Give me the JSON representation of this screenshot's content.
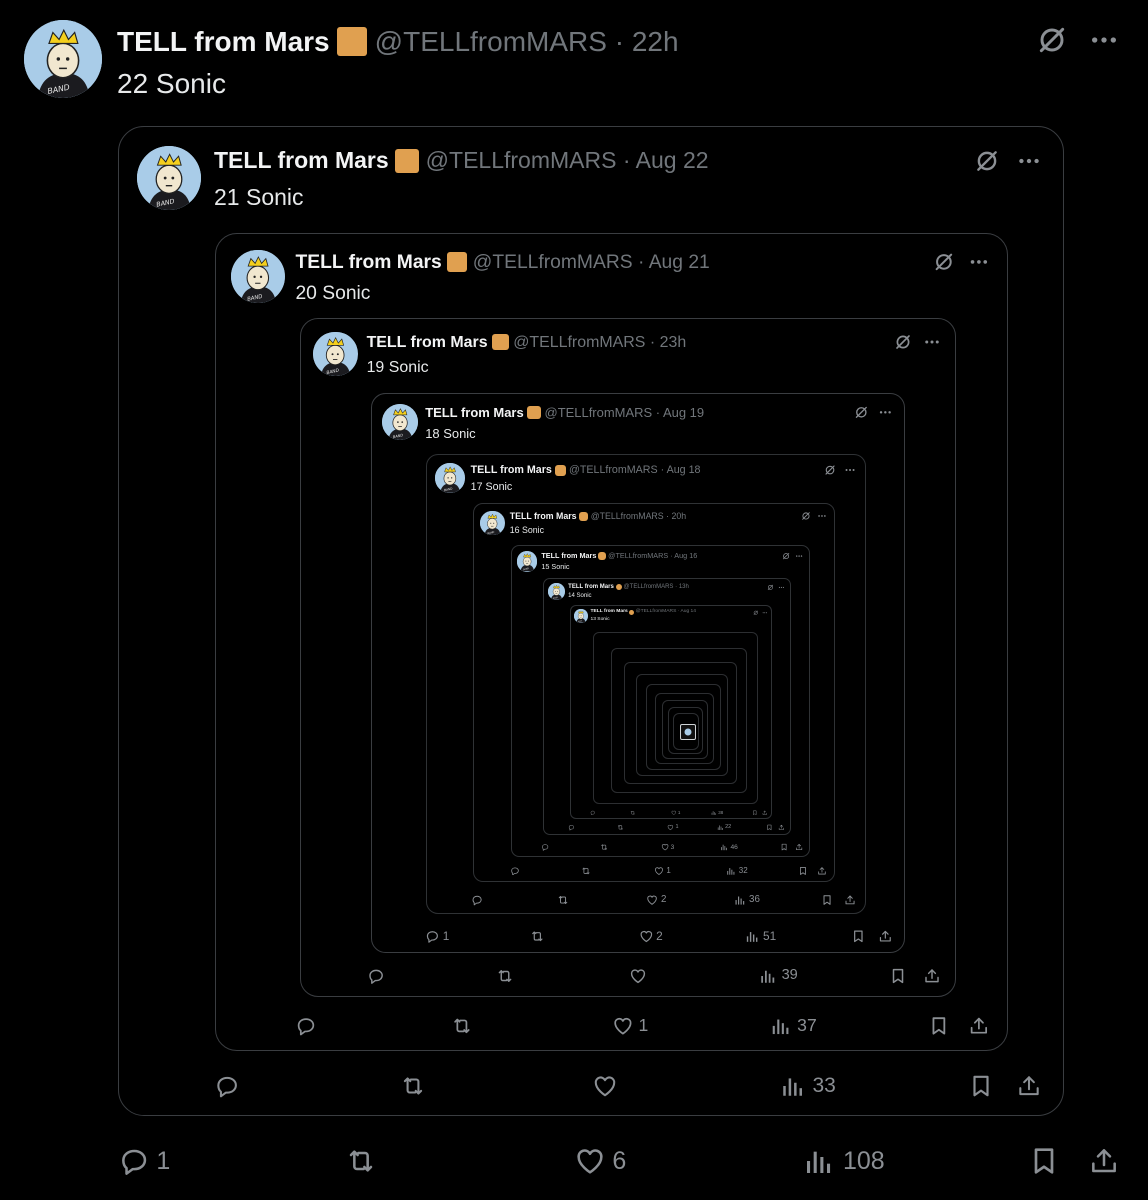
{
  "author": {
    "name": "TELL from Mars",
    "handle": "@TELLfromMARS"
  },
  "main_post": {
    "time": "· 22h",
    "text": "22 Sonic",
    "actions": {
      "replies": "1",
      "reposts": "",
      "likes": "6",
      "views": "108"
    }
  },
  "quotes": [
    {
      "time": "· Aug 22",
      "text": "21 Sonic",
      "replies": "",
      "likes": "",
      "views": "33"
    },
    {
      "time": "· Aug 21",
      "text": "20 Sonic",
      "replies": "",
      "likes": "1",
      "views": "37"
    },
    {
      "time": "· 23h",
      "text": "19 Sonic",
      "replies": "",
      "likes": "",
      "views": "39"
    },
    {
      "time": "· Aug 19",
      "text": "18 Sonic",
      "replies": "1",
      "likes": "2",
      "views": "51"
    },
    {
      "time": "· Aug 18",
      "text": "17 Sonic",
      "replies": "",
      "likes": "2",
      "views": "36"
    },
    {
      "time": "· 20h",
      "text": "16 Sonic",
      "replies": "",
      "likes": "1",
      "views": "32"
    },
    {
      "time": "· Aug 16",
      "text": "15 Sonic",
      "replies": "",
      "likes": "3",
      "views": "46"
    },
    {
      "time": "· 13h",
      "text": "14 Sonic",
      "replies": "",
      "likes": "1",
      "views": "22"
    },
    {
      "time": "· Aug 14",
      "text": "13 Sonic",
      "replies": "",
      "likes": "1",
      "views": "38"
    }
  ],
  "icons": {
    "avatar": "cartoon-avatar-with-crown",
    "badge": "verified-gold-square",
    "grok": "slashed-circle-icon",
    "more": "more-icon",
    "reply": "reply-icon",
    "repost": "repost-icon",
    "like": "heart-icon",
    "views": "views-icon",
    "bookmark": "bookmark-icon",
    "share": "share-icon"
  },
  "colors": {
    "background": "#000000",
    "text": "#e7e9ea",
    "muted": "#71767b",
    "badge": "#e0a050",
    "border": "#3a3d41"
  }
}
